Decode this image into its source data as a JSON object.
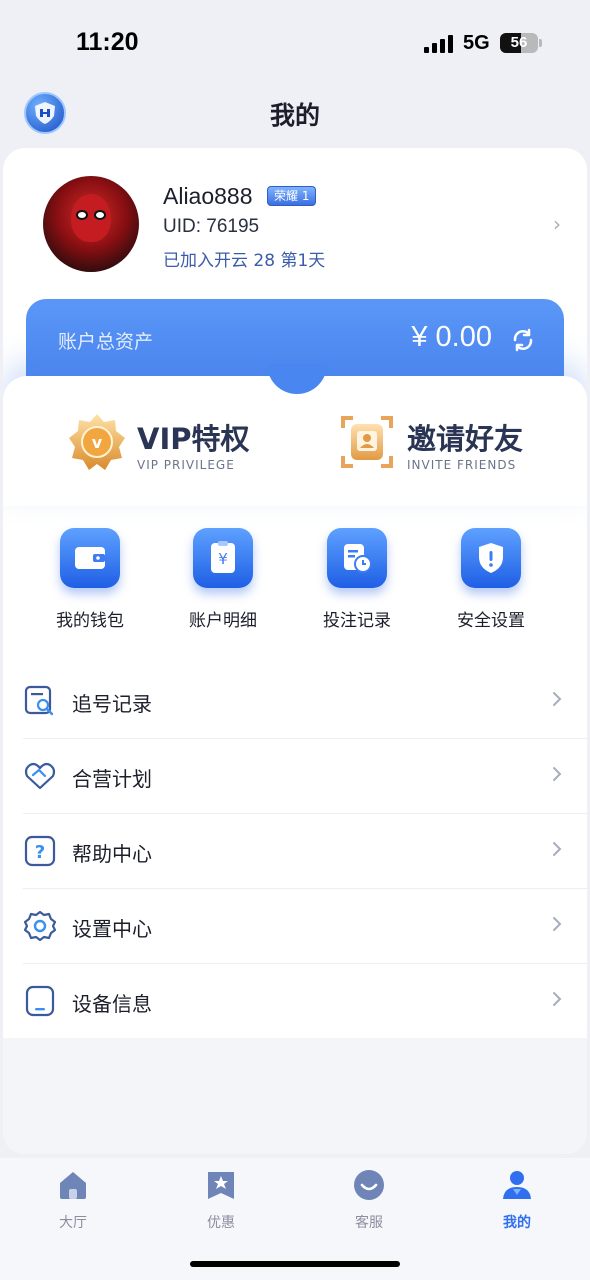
{
  "status_bar": {
    "time": "11:20",
    "network": "5G",
    "battery": "56",
    "battery_level": 0.56
  },
  "header": {
    "title": "我的",
    "logo_icon": "shield-logo-icon"
  },
  "profile": {
    "username": "Aliao888",
    "badge": "荣耀 1",
    "uid": "UID: 76195",
    "joined": "已加入开云 28 第1天",
    "avatar": "avatar-image"
  },
  "assets": {
    "label": "账户总资产",
    "amount": "¥ 0.00",
    "refresh_icon": "refresh-icon"
  },
  "privileges": [
    {
      "title": "VIP特权",
      "subtitle": "VIP PRIVILEGE",
      "icon": "vip-medal-icon"
    },
    {
      "title": "邀请好友",
      "subtitle": "INVITE FRIENDS",
      "icon": "invite-card-icon"
    }
  ],
  "shortcuts": [
    {
      "label": "我的钱包",
      "icon": "wallet-icon"
    },
    {
      "label": "账户明细",
      "icon": "bill-icon"
    },
    {
      "label": "投注记录",
      "icon": "bet-record-icon"
    },
    {
      "label": "安全设置",
      "icon": "security-shield-icon"
    }
  ],
  "menu": [
    {
      "label": "追号记录",
      "icon": "search-record-icon"
    },
    {
      "label": "合营计划",
      "icon": "handshake-icon"
    },
    {
      "label": "帮助中心",
      "icon": "help-icon"
    },
    {
      "label": "设置中心",
      "icon": "gear-icon"
    },
    {
      "label": "设备信息",
      "icon": "device-icon"
    }
  ],
  "tabs": [
    {
      "label": "大厅",
      "icon": "home-icon",
      "active": false
    },
    {
      "label": "优惠",
      "icon": "star-bookmark-icon",
      "active": false
    },
    {
      "label": "客服",
      "icon": "chat-icon",
      "active": false
    },
    {
      "label": "我的",
      "icon": "user-icon",
      "active": true
    }
  ],
  "colors": {
    "accent": "#2f6ff0",
    "asset_bar": "#4a86ef",
    "text": "#1c1f2b"
  }
}
